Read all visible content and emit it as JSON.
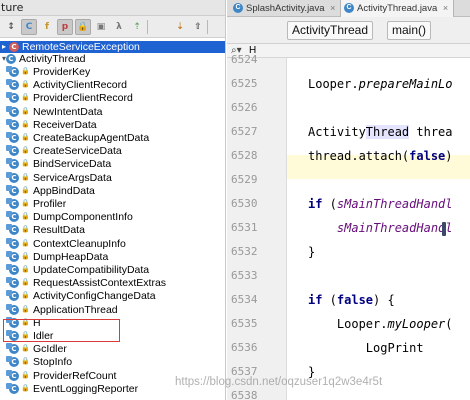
{
  "structure": {
    "title": "ture",
    "toolbar": [
      {
        "name": "sort-visibility-icon",
        "glyph": "↕"
      },
      {
        "name": "filter-class-icon",
        "glyph": "C"
      },
      {
        "name": "filter-field-icon",
        "glyph": "f"
      },
      {
        "name": "filter-property-icon",
        "glyph": "p"
      },
      {
        "name": "lock-filter-icon",
        "glyph": "🔒"
      },
      {
        "name": "show-anonymous-icon",
        "glyph": "▣"
      },
      {
        "name": "show-lambda-icon",
        "glyph": "λ"
      },
      {
        "name": "show-inherited-icon",
        "glyph": "⇡"
      },
      {
        "name": "autoscroll-from-source-icon",
        "glyph": "⇣"
      },
      {
        "name": "autoscroll-to-source-icon",
        "glyph": "⇧"
      }
    ],
    "selected_item": "RemoteServiceException",
    "root_item": "ActivityThread",
    "items": [
      {
        "label": "ProviderKey"
      },
      {
        "label": "ActivityClientRecord"
      },
      {
        "label": "ProviderClientRecord"
      },
      {
        "label": "NewIntentData"
      },
      {
        "label": "ReceiverData"
      },
      {
        "label": "CreateBackupAgentData"
      },
      {
        "label": "CreateServiceData"
      },
      {
        "label": "BindServiceData"
      },
      {
        "label": "ServiceArgsData"
      },
      {
        "label": "AppBindData"
      },
      {
        "label": "Profiler"
      },
      {
        "label": "DumpComponentInfo"
      },
      {
        "label": "ResultData"
      },
      {
        "label": "ContextCleanupInfo"
      },
      {
        "label": "DumpHeapData"
      },
      {
        "label": "UpdateCompatibilityData"
      },
      {
        "label": "RequestAssistContextExtras"
      },
      {
        "label": "ActivityConfigChangeData"
      },
      {
        "label": "ApplicationThread"
      },
      {
        "label": "H"
      },
      {
        "label": "Idler"
      },
      {
        "label": "GcIdler"
      },
      {
        "label": "StopInfo"
      },
      {
        "label": "ProviderRefCount"
      },
      {
        "label": "EventLoggingReporter"
      }
    ]
  },
  "editor": {
    "tabs": [
      {
        "label": "SplashActivity.java",
        "close": "×",
        "active": false
      },
      {
        "label": "ActivityThread.java",
        "close": "×",
        "active": true
      }
    ],
    "breadcrumbs": [
      "ActivityThread",
      "main()"
    ],
    "search_text": "H",
    "line_numbers": [
      "6524",
      "6525",
      "6526",
      "6527",
      "6528",
      "6529",
      "6530",
      "6531",
      "6532",
      "6533",
      "6534",
      "6535",
      "6536",
      "6537",
      "6538"
    ],
    "code_lines": [
      "",
      "Looper.prepareMainLo",
      "",
      "ActivityThread threa",
      "thread.attach(false)",
      "",
      "if (sMainThreadHandl",
      "    sMainThreadHandl",
      "}",
      "",
      "if (false) {",
      "    Looper.myLooper(",
      "        LogPrint",
      "}",
      ""
    ]
  },
  "watermark": "https://blog.csdn.net/oqzuser1q2w3e4r5t",
  "colors": {
    "selection": "#1f62d1",
    "highlight_box": "#d93a3a",
    "class_icon": "#3e86c6",
    "keyword": "#000080",
    "field": "#660e7a"
  }
}
